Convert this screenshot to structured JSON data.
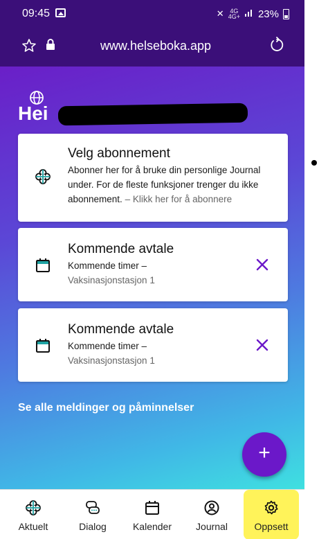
{
  "status_bar": {
    "time": "09:45",
    "network_top": "4G",
    "network_bottom": "4G+",
    "battery": "23%"
  },
  "browser": {
    "url": "www.helseboka.app"
  },
  "greeting": {
    "text": "Hei"
  },
  "cards": [
    {
      "title": "Velg abonnement",
      "body": "Abonner her for å bruke din personlige Journal under. For de fleste funksjoner trenger du ikke abonnement.",
      "link": " – Klikk her for å abonnere",
      "icon": "clover-icon"
    },
    {
      "title": "Kommende avtale",
      "line1": "Kommende timer –",
      "line2": "Vaksinasjonstasjon 1",
      "icon": "calendar-icon"
    },
    {
      "title": "Kommende avtale",
      "line1": "Kommende timer –",
      "line2": "Vaksinasjonstasjon 1",
      "icon": "calendar-icon"
    }
  ],
  "messages_link": "Se alle meldinger og påminnelser",
  "fab": {
    "label": "+"
  },
  "nav": {
    "items": [
      {
        "label": "Aktuelt",
        "icon": "clover-icon"
      },
      {
        "label": "Dialog",
        "icon": "chat-icon"
      },
      {
        "label": "Kalender",
        "icon": "calendar-icon"
      },
      {
        "label": "Journal",
        "icon": "person-circle-icon"
      },
      {
        "label": "Oppsett",
        "icon": "gear-icon",
        "highlighted": true
      }
    ]
  },
  "colors": {
    "status_bar": "#3b0f79",
    "accent": "#6b18c9",
    "highlight": "#fff35a",
    "teal": "#1fa3a3"
  }
}
